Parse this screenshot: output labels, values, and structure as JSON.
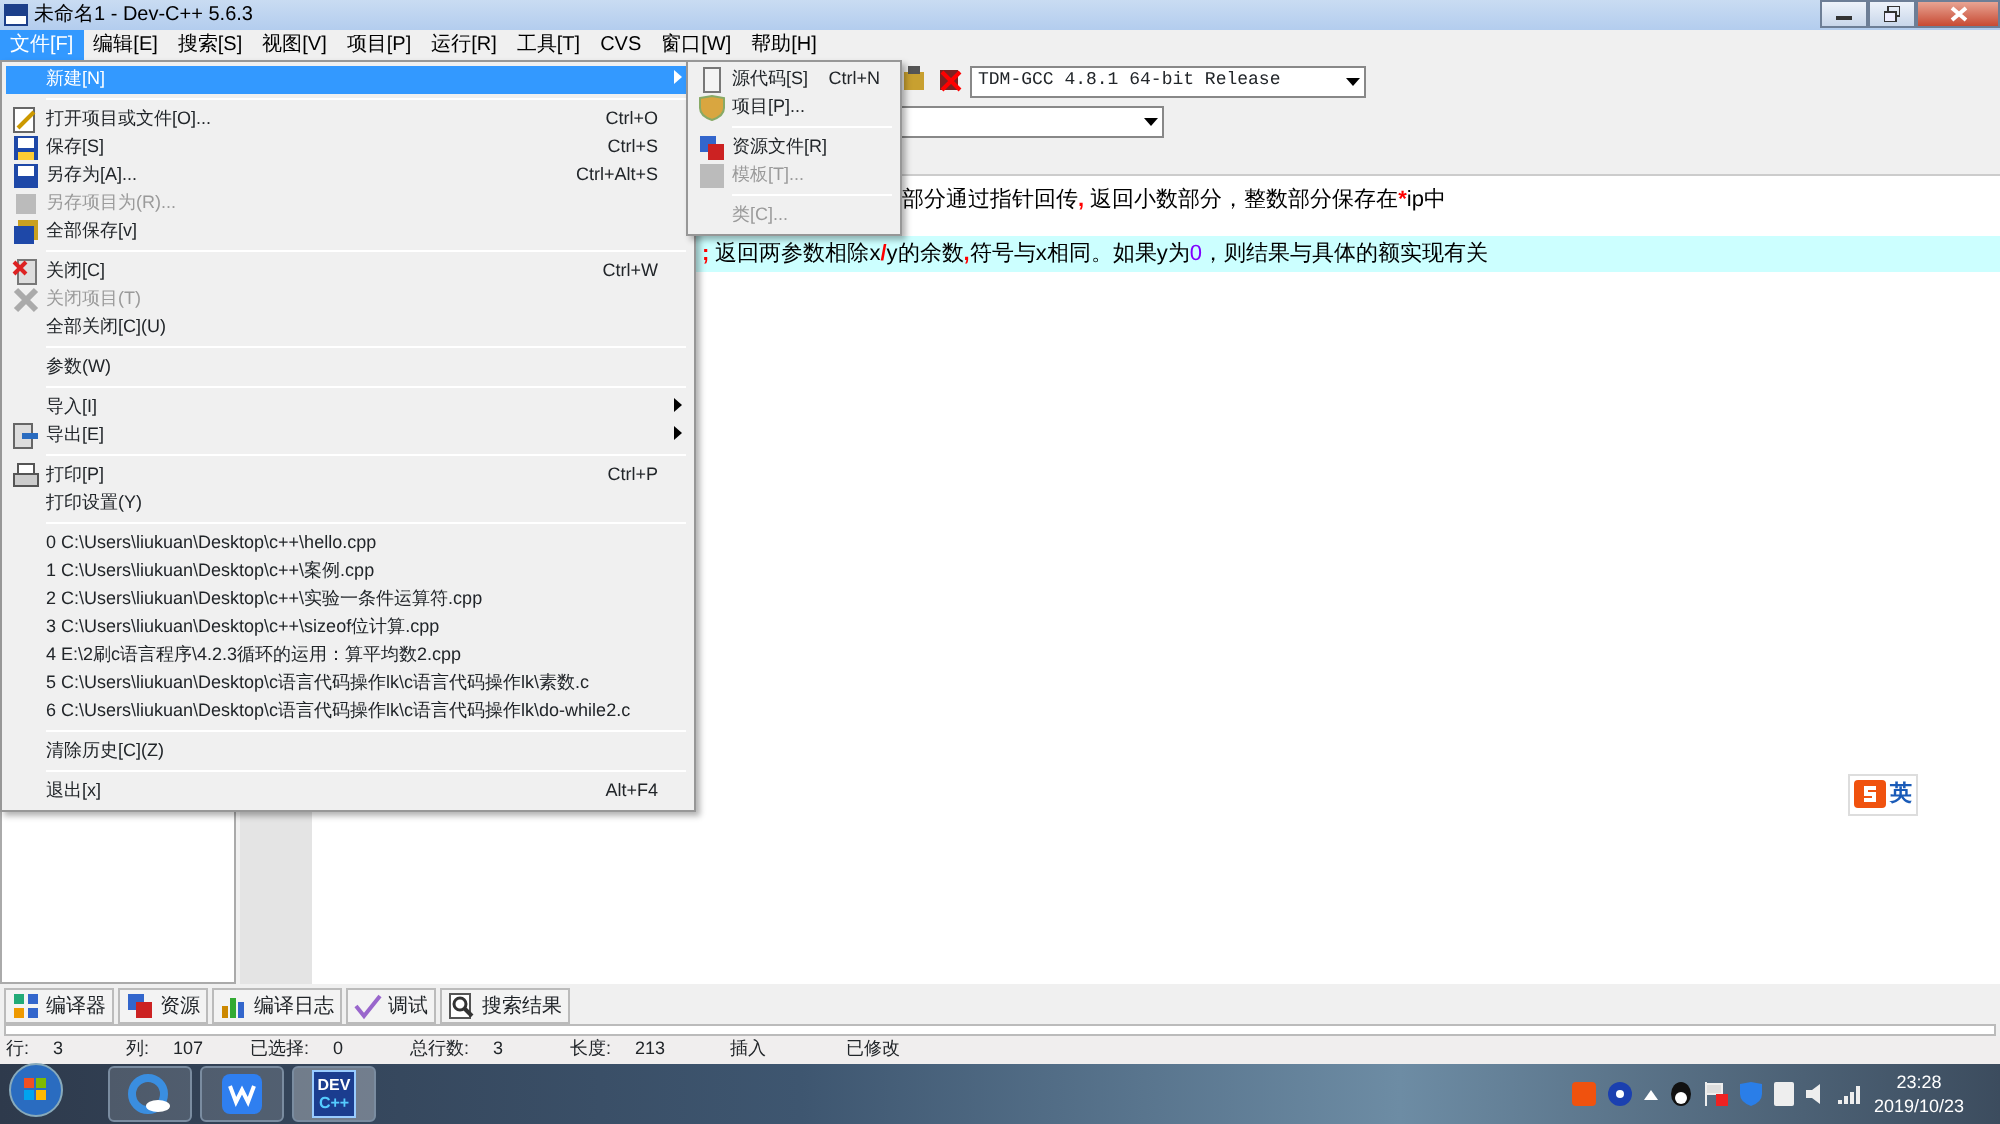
{
  "window": {
    "title": "未命名1 - Dev-C++ 5.6.3"
  },
  "menubar": [
    {
      "label": "文件[F]",
      "selected": true
    },
    {
      "label": "编辑[E]",
      "selected": false
    },
    {
      "label": "搜索[S]",
      "selected": false
    },
    {
      "label": "视图[V]",
      "selected": false
    },
    {
      "label": "项目[P]",
      "selected": false
    },
    {
      "label": "运行[R]",
      "selected": false
    },
    {
      "label": "工具[T]",
      "selected": false
    },
    {
      "label": "CVS",
      "selected": false
    },
    {
      "label": "窗口[W]",
      "selected": false
    },
    {
      "label": "帮助[H]",
      "selected": false
    }
  ],
  "toolbar": {
    "compiler": "TDM-GCC 4.8.1 64-bit Release"
  },
  "file_menu": [
    {
      "kind": "item",
      "label": "新建[N]",
      "selected": true,
      "disabled": false,
      "submenu": true
    },
    {
      "kind": "separator"
    },
    {
      "kind": "item",
      "label": "打开项目或文件[O]...",
      "shortcut": "Ctrl+O",
      "selected": false,
      "disabled": false,
      "submenu": false
    },
    {
      "kind": "item",
      "label": "保存[S]",
      "shortcut": "Ctrl+S",
      "selected": false,
      "disabled": false,
      "submenu": false
    },
    {
      "kind": "item",
      "label": "另存为[A]...",
      "shortcut": "Ctrl+Alt+S",
      "selected": false,
      "disabled": false,
      "submenu": false
    },
    {
      "kind": "item",
      "label": "另存项目为(R)...",
      "selected": false,
      "disabled": true,
      "submenu": false
    },
    {
      "kind": "item",
      "label": "全部保存[v]",
      "selected": false,
      "disabled": false,
      "submenu": false
    },
    {
      "kind": "separator"
    },
    {
      "kind": "item",
      "label": "关闭[C]",
      "shortcut": "Ctrl+W",
      "selected": false,
      "disabled": false,
      "submenu": false
    },
    {
      "kind": "item",
      "label": "关闭项目(T)",
      "selected": false,
      "disabled": true,
      "submenu": false
    },
    {
      "kind": "item",
      "label": "全部关闭[C](U)",
      "selected": false,
      "disabled": false,
      "submenu": false
    },
    {
      "kind": "separator"
    },
    {
      "kind": "item",
      "label": "参数(W)",
      "selected": false,
      "disabled": false,
      "submenu": false
    },
    {
      "kind": "separator"
    },
    {
      "kind": "item",
      "label": "导入[I]",
      "selected": false,
      "disabled": false,
      "submenu": true
    },
    {
      "kind": "item",
      "label": "导出[E]",
      "selected": false,
      "disabled": false,
      "submenu": true
    },
    {
      "kind": "separator"
    },
    {
      "kind": "item",
      "label": "打印[P]",
      "shortcut": "Ctrl+P",
      "selected": false,
      "disabled": false,
      "submenu": false
    },
    {
      "kind": "item",
      "label": "打印设置(Y)",
      "selected": false,
      "disabled": false,
      "submenu": false
    },
    {
      "kind": "separator"
    },
    {
      "kind": "item",
      "label": "0 C:\\Users\\liukuan\\Desktop\\c++\\hello.cpp",
      "selected": false,
      "disabled": false,
      "submenu": false
    },
    {
      "kind": "item",
      "label": "1 C:\\Users\\liukuan\\Desktop\\c++\\案例.cpp",
      "selected": false,
      "disabled": false,
      "submenu": false
    },
    {
      "kind": "item",
      "label": "2 C:\\Users\\liukuan\\Desktop\\c++\\实验一条件运算符.cpp",
      "selected": false,
      "disabled": false,
      "submenu": false
    },
    {
      "kind": "item",
      "label": "3 C:\\Users\\liukuan\\Desktop\\c++\\sizeof位计算.cpp",
      "selected": false,
      "disabled": false,
      "submenu": false
    },
    {
      "kind": "item",
      "label": "4 E:\\2刷c语言程序\\4.2.3循环的运用：算平均数2.cpp",
      "selected": false,
      "disabled": false,
      "submenu": false
    },
    {
      "kind": "item",
      "label": "5 C:\\Users\\liukuan\\Desktop\\c语言代码操作lk\\c语言代码操作lk\\素数.c",
      "selected": false,
      "disabled": false,
      "submenu": false
    },
    {
      "kind": "item",
      "label": "6 C:\\Users\\liukuan\\Desktop\\c语言代码操作lk\\c语言代码操作lk\\do-while2.c",
      "selected": false,
      "disabled": false,
      "submenu": false
    },
    {
      "kind": "separator"
    },
    {
      "kind": "item",
      "label": "清除历史[C](Z)",
      "selected": false,
      "disabled": false,
      "submenu": false
    },
    {
      "kind": "separator"
    },
    {
      "kind": "item",
      "label": "退出[x]",
      "shortcut": "Alt+F4",
      "selected": false,
      "disabled": false,
      "submenu": false
    }
  ],
  "new_submenu": [
    {
      "kind": "item",
      "label": "源代码[S]",
      "shortcut": "Ctrl+N",
      "disabled": false
    },
    {
      "kind": "item",
      "label": "项目[P]...",
      "disabled": false
    },
    {
      "kind": "separator"
    },
    {
      "kind": "item",
      "label": "资源文件[R]",
      "disabled": false
    },
    {
      "kind": "item",
      "label": "模板[T]...",
      "disabled": true
    },
    {
      "kind": "separator"
    },
    {
      "kind": "item",
      "label": "类[C]...",
      "disabled": true
    }
  ],
  "editor": {
    "lines": [
      {
        "highlighted": false,
        "segments": [
          {
            "kind": "plain",
            "text": "部分通过指针回传"
          },
          {
            "kind": "symbol",
            "text": ","
          },
          {
            "kind": "plain",
            "text": " 返回小数部分，整数部分保存在"
          },
          {
            "kind": "symbol",
            "text": "*"
          },
          {
            "kind": "plain",
            "text": "ip中"
          }
        ]
      },
      {
        "highlighted": true,
        "segments": [
          {
            "kind": "symbol",
            "text": ";"
          },
          {
            "kind": "plain",
            "text": " 返回两参数相除x"
          },
          {
            "kind": "symbol",
            "text": "/"
          },
          {
            "kind": "plain",
            "text": "y的余数"
          },
          {
            "kind": "symbol",
            "text": ","
          },
          {
            "kind": "plain",
            "text": "符号与x相同。如果y为"
          },
          {
            "kind": "number",
            "text": "0"
          },
          {
            "kind": "plain",
            "text": "，则结果与具体的额实现有关"
          }
        ]
      }
    ]
  },
  "ime": {
    "mode": "英"
  },
  "bottom_tabs": [
    {
      "label": "编译器"
    },
    {
      "label": "资源"
    },
    {
      "label": "编译日志"
    },
    {
      "label": "调试"
    },
    {
      "label": "搜索结果"
    }
  ],
  "status_bar": [
    {
      "label": "行:",
      "value": "3"
    },
    {
      "label": "列:",
      "value": "107"
    },
    {
      "label": "已选择:",
      "value": "0"
    },
    {
      "label": "总行数:",
      "value": "3"
    },
    {
      "label": "长度:",
      "value": "213"
    },
    {
      "label": "插入"
    },
    {
      "label": "已修改"
    }
  ],
  "taskbar": {
    "app_logo": [
      "DEV",
      "C++"
    ],
    "time": "23:28",
    "date": "2019/10/23"
  }
}
